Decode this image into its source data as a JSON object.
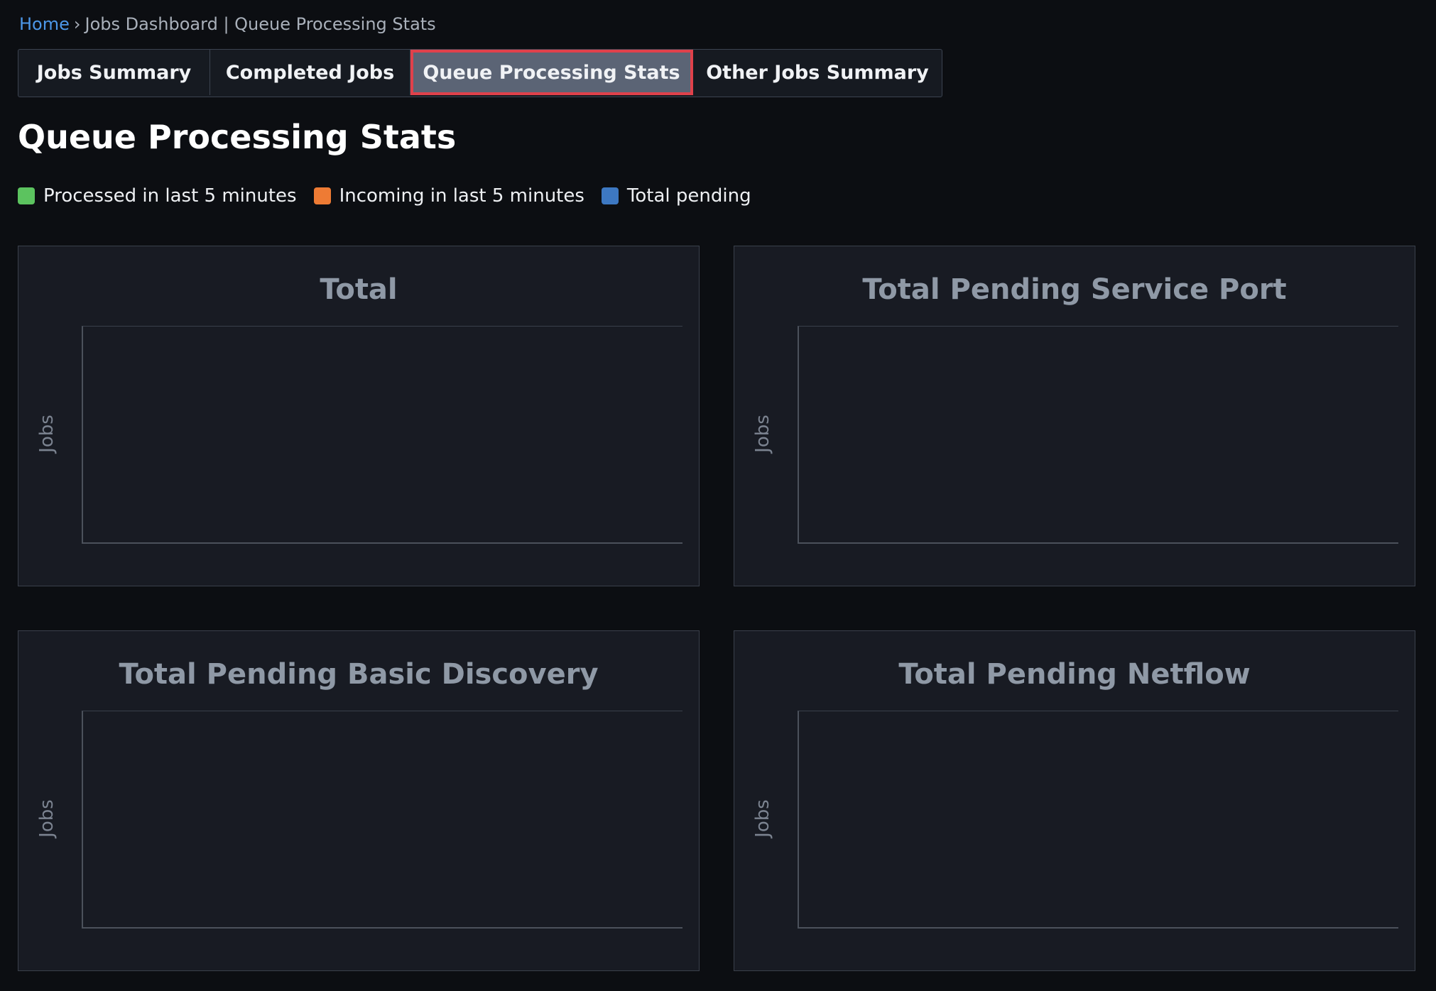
{
  "breadcrumb": {
    "home": "Home",
    "separator": "›",
    "current": "Jobs Dashboard | Queue Processing Stats"
  },
  "tabs": [
    {
      "label": "Jobs Summary",
      "active": false
    },
    {
      "label": "Completed Jobs",
      "active": false
    },
    {
      "label": "Queue Processing Stats",
      "active": true
    },
    {
      "label": "Other Jobs Summary",
      "active": false
    }
  ],
  "page_title": "Queue Processing Stats",
  "legend": [
    {
      "label": "Processed in last 5 minutes",
      "color": "#5cc35f"
    },
    {
      "label": "Incoming in last 5 minutes",
      "color": "#ee7b34"
    },
    {
      "label": "Total pending",
      "color": "#3d78c2"
    }
  ],
  "charts": [
    {
      "title": "Total",
      "ylabel": "Jobs"
    },
    {
      "title": "Total Pending Service Port",
      "ylabel": "Jobs"
    },
    {
      "title": "Total Pending Basic Discovery",
      "ylabel": "Jobs"
    },
    {
      "title": "Total Pending Netflow",
      "ylabel": "Jobs"
    }
  ]
}
